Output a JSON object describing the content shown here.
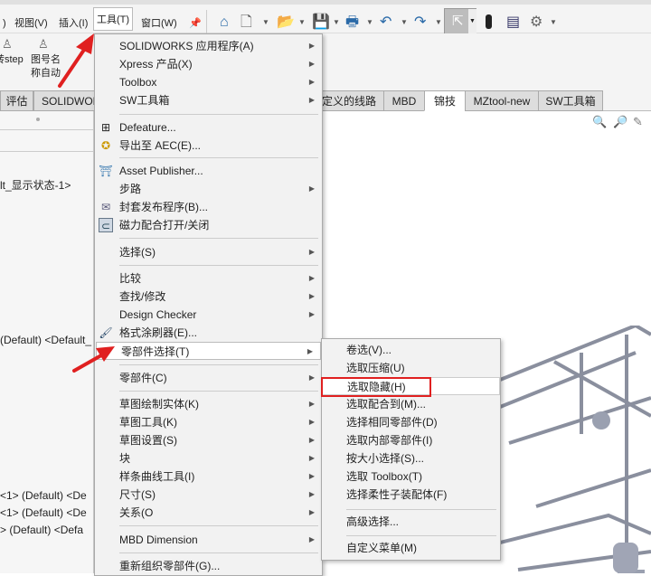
{
  "menubar": {
    "items": [
      ")",
      "视图(V)",
      "插入(I)",
      "工具(T)",
      "窗口(W)"
    ],
    "pin_icon": "pin-icon"
  },
  "toolbar": {
    "icons": [
      "home-icon",
      "new-file-icon",
      "open-icon",
      "save-icon",
      "print-icon",
      "undo-icon",
      "redo-icon",
      "select-cursor-icon",
      "traffic-light-icon",
      "options-list-icon",
      "gear-icon"
    ]
  },
  "ribbon": {
    "buttons": [
      {
        "label1": "转step",
        "label2": ""
      },
      {
        "label1": "图号名",
        "label2": "称自动"
      }
    ]
  },
  "tabs": [
    {
      "label": "评估"
    },
    {
      "label": "SOLIDWORKS"
    },
    {
      "label": "定义的线路"
    },
    {
      "label": "MBD"
    },
    {
      "label": "锦技",
      "active": true
    },
    {
      "label": "MZtool-new"
    },
    {
      "label": "SW工具箱"
    }
  ],
  "tree": [
    "lt_显示状态-1>",
    "(Default) <Default_",
    "<1> (Default) <De",
    "<1> (Default) <De",
    " > (Default) <Defa"
  ],
  "main_menu": {
    "items": [
      "SOLIDWORKS 应用程序(A)",
      "Xpress 产品(X)",
      "Toolbox",
      "SW工具箱",
      "Defeature...",
      "导出至 AEC(E)...",
      "Asset Publisher...",
      "步路",
      "封套发布程序(B)...",
      "磁力配合打开/关闭",
      "选择(S)",
      "比较",
      "查找/修改",
      "Design Checker",
      "格式涂刷器(E)...",
      "零部件选择(T)",
      "零部件(C)",
      "草图绘制实体(K)",
      "草图工具(K)",
      "草图设置(S)",
      "块",
      "样条曲线工具(I)",
      "尺寸(S)",
      "关系(O",
      "MBD Dimension",
      "重新组织零部件(G)..."
    ],
    "highlighted": "零部件选择(T)"
  },
  "sub_menu": {
    "items": [
      "卷选(V)...",
      "选取压缩(U)",
      "选取隐藏(H)",
      "选取配合到(M)...",
      "选择相同零部件(D)",
      "选取内部零部件(I)",
      "按大小选择(S)...",
      "选取 Toolbox(T)",
      "选择柔性子装配体(F)",
      "高级选择...",
      "自定义菜单(M)"
    ],
    "highlighted": "选取隐藏(H)"
  },
  "colors": {
    "annotation_red": "#e02020",
    "menu_bg": "#f2f2f2",
    "accent_blue": "#2a6aa8"
  }
}
